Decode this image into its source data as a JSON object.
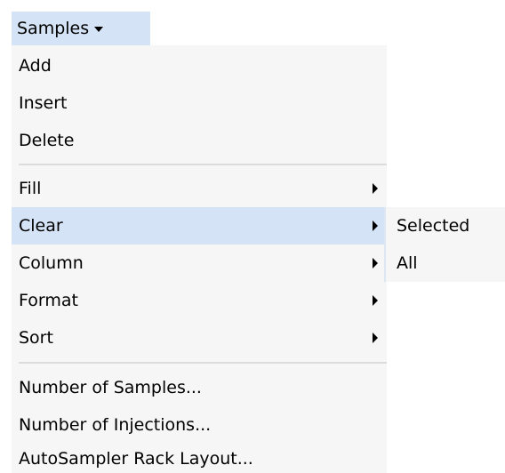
{
  "menu_button": {
    "label": "Samples",
    "icon": "chevron-down-icon"
  },
  "menu": {
    "add": "Add",
    "insert": "Insert",
    "delete": "Delete",
    "fill": "Fill",
    "clear": "Clear",
    "column": "Column",
    "format": "Format",
    "sort": "Sort",
    "number_of_samples": "Number of Samples...",
    "number_of_injections": "Number of Injections...",
    "autosampler_rack_layout": "AutoSampler Rack Layout..."
  },
  "clear_submenu": {
    "selected": "Selected",
    "all": "All"
  },
  "colors": {
    "highlight": "#d4e3f5",
    "menu_background": "#f6f6f6"
  }
}
